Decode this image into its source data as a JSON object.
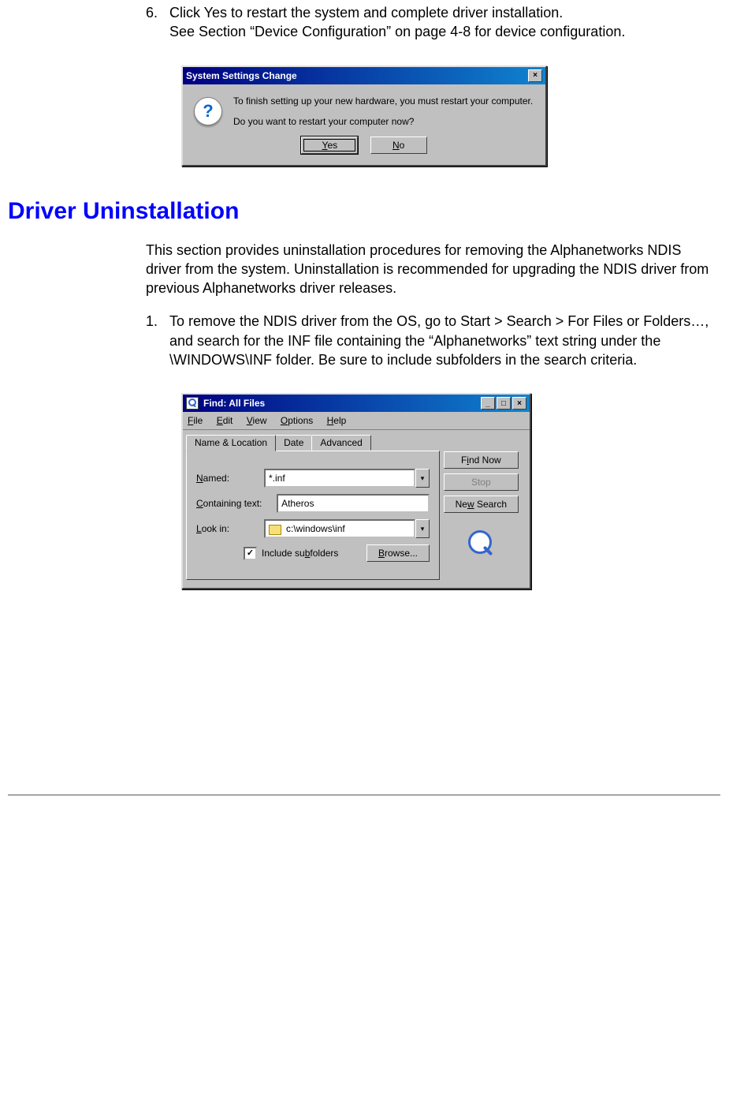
{
  "step6": {
    "num": "6.",
    "line1": "Click Yes to restart the system and complete driver installation.",
    "line2": "See Section “Device Configuration” on page 4-8 for device configuration."
  },
  "dialog1": {
    "title": "System Settings Change",
    "msg1": "To finish setting up your new hardware, you must restart your computer.",
    "msg2": "Do you want to restart your computer now?",
    "yes": "Yes",
    "no": "No",
    "close": "×",
    "qmark": "?"
  },
  "heading": "Driver Uninstallation",
  "para": "This section provides uninstallation procedures for removing the Alphanetworks NDIS driver from the system. Uninstallation is recommended for upgrading the NDIS driver from previous Alphanetworks driver releases.",
  "step1": {
    "num": "1.",
    "text": "To remove the NDIS driver from the OS, go to Start > Search > For Files or Folders…, and search for the INF file containing the “Alphanetworks” text string under the \\WINDOWS\\INF folder. Be sure to include subfolders in the search criteria."
  },
  "find": {
    "title": "Find: All Files",
    "menu": {
      "file": "File",
      "edit": "Edit",
      "view": "View",
      "options": "Options",
      "help": "Help"
    },
    "tabs": {
      "name_loc": "Name & Location",
      "date": "Date",
      "advanced": "Advanced"
    },
    "labels": {
      "named": "Named:",
      "containing": "Containing text:",
      "lookin": "Look in:",
      "include": "Include subfolders",
      "browse": "Browse..."
    },
    "values": {
      "named": "*.inf",
      "containing": "Atheros",
      "lookin": "c:\\windows\\inf"
    },
    "buttons": {
      "findnow": "Find Now",
      "stop": "Stop",
      "newsearch": "New Search"
    },
    "winbtns": {
      "min": "_",
      "max": "□",
      "close": "×"
    },
    "check": "✓",
    "caret": "▾"
  }
}
